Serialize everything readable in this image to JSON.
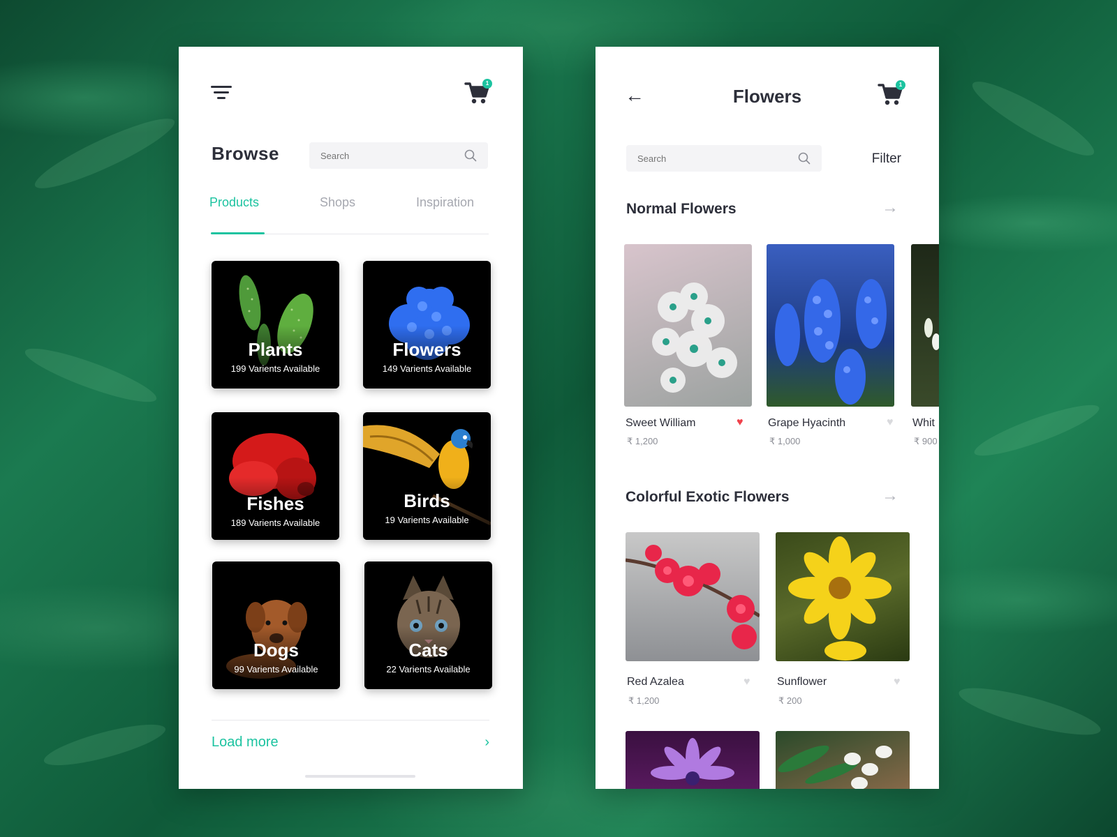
{
  "browse": {
    "title": "Browse",
    "search_placeholder": "Search",
    "cart_count": "1",
    "tabs": [
      {
        "label": "Products",
        "active": true
      },
      {
        "label": "Shops",
        "active": false
      },
      {
        "label": "Inspiration",
        "active": false
      }
    ],
    "categories": [
      {
        "name": "Plants",
        "sub": "199 Varients Available"
      },
      {
        "name": "Flowers",
        "sub": "149 Varients Available"
      },
      {
        "name": "Fishes",
        "sub": "189 Varients Available"
      },
      {
        "name": "Birds",
        "sub": "19 Varients Available"
      },
      {
        "name": "Dogs",
        "sub": "99 Varients Available"
      },
      {
        "name": "Cats",
        "sub": "22 Varients Available"
      }
    ],
    "load_more": "Load more"
  },
  "flowers": {
    "title": "Flowers",
    "cart_count": "1",
    "search_placeholder": "Search",
    "filter_label": "Filter",
    "sections": [
      {
        "title": "Normal Flowers",
        "items": [
          {
            "name": "Sweet William",
            "price": "₹ 1,200",
            "liked": true
          },
          {
            "name": "Grape Hyacinth",
            "price": "₹ 1,000",
            "liked": false
          },
          {
            "name": "Whit",
            "price": "₹ 900",
            "liked": false
          }
        ]
      },
      {
        "title": "Colorful Exotic Flowers",
        "items": [
          {
            "name": "Red Azalea",
            "price": "₹ 1,200",
            "liked": false
          },
          {
            "name": "Sunflower",
            "price": "₹ 200",
            "liked": false
          }
        ]
      }
    ]
  },
  "colors": {
    "accent": "#1cc3a0",
    "text_dark": "#2d2f3a",
    "text_muted": "#a6a8b0",
    "heart_active": "#f0424b"
  }
}
